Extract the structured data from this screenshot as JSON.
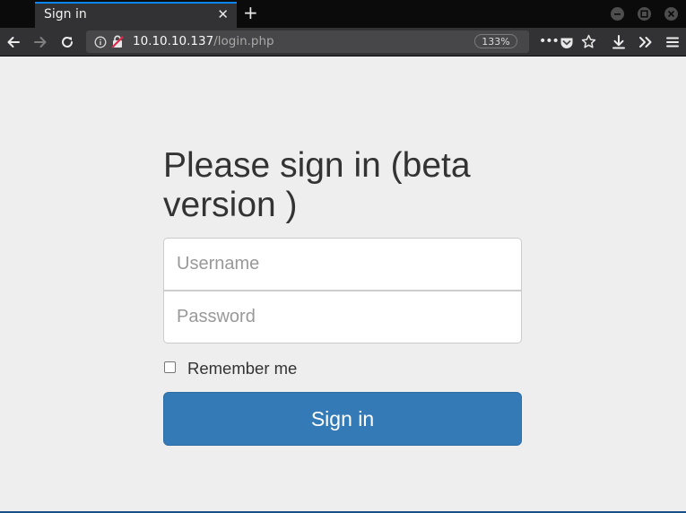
{
  "browser": {
    "tab_title": "Sign in",
    "url_host": "10.10.10.137",
    "url_path": "/login.php",
    "zoom": "133%",
    "accent_color": "#0a84ff"
  },
  "icons": {
    "back": "back-arrow-icon",
    "forward": "forward-arrow-icon",
    "reload": "reload-icon",
    "info": "info-icon",
    "insecure": "insecure-lock-icon",
    "more": "more-actions-icon",
    "pocket": "pocket-icon",
    "bookmark": "star-icon",
    "download": "download-icon",
    "overflow": "overflow-chevrons-icon",
    "menu": "hamburger-menu-icon",
    "close_tab": "close-icon",
    "new_tab": "plus-icon"
  },
  "login": {
    "heading": "Please sign in (beta version )",
    "username_placeholder": "Username",
    "password_placeholder": "Password",
    "remember_label": "Remember me",
    "remember_checked": false,
    "submit_label": "Sign in",
    "button_color": "#337ab7",
    "background_color": "#eeeeee"
  }
}
